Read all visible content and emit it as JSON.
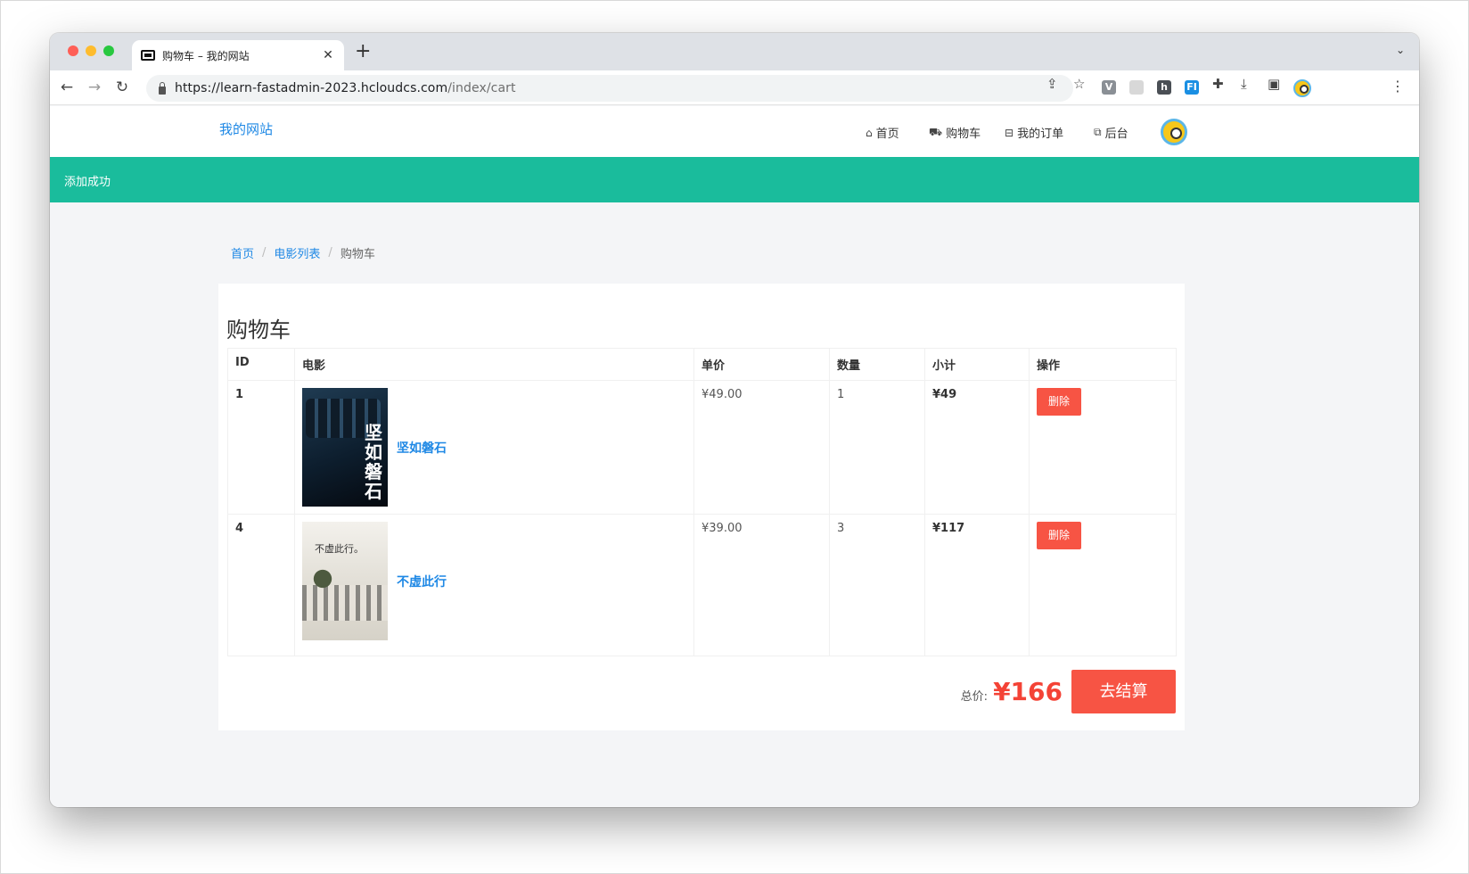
{
  "browser": {
    "tab_title": "购物车 – 我的网站",
    "url_host": "https://learn-fastadmin-2023.hcloudcs.com",
    "url_path": "/index/cart",
    "icons": [
      "back-arrow-icon",
      "forward-arrow-icon",
      "reload-icon",
      "lock-icon",
      "share-icon",
      "star-icon",
      "extensions-icon",
      "download-icon",
      "sidebar-icon",
      "profile-icon",
      "kebab-menu-icon"
    ]
  },
  "site": {
    "brand": "我的网站",
    "nav": [
      {
        "label": "首页",
        "icon": "home-icon"
      },
      {
        "label": "购物车",
        "icon": "cart-icon"
      },
      {
        "label": "我的订单",
        "icon": "basket-icon"
      },
      {
        "label": "后台",
        "icon": "external-link-icon"
      }
    ],
    "flash_message": "添加成功"
  },
  "breadcrumb": {
    "items": [
      "首页",
      "电影列表"
    ],
    "current": "购物车"
  },
  "cart": {
    "title": "购物车",
    "headers": [
      "ID",
      "电影",
      "单价",
      "数量",
      "小计",
      "操作"
    ],
    "rows": [
      {
        "id": "1",
        "title": "坚如磐石",
        "poster_text": "坚如磐石",
        "price": "¥49.00",
        "qty": "1",
        "subtotal": "¥49",
        "action": "删除"
      },
      {
        "id": "4",
        "title": "不虚此行",
        "poster_text": "不虚此行。",
        "price": "¥39.00",
        "qty": "3",
        "subtotal": "¥117",
        "action": "删除"
      }
    ],
    "total_label": "总价:",
    "total_value": "¥166",
    "checkout_label": "去结算"
  },
  "colors": {
    "accent": "#1e88e5",
    "flash_bg": "#1abc9c",
    "danger": "#f75444",
    "total": "#f44336"
  }
}
